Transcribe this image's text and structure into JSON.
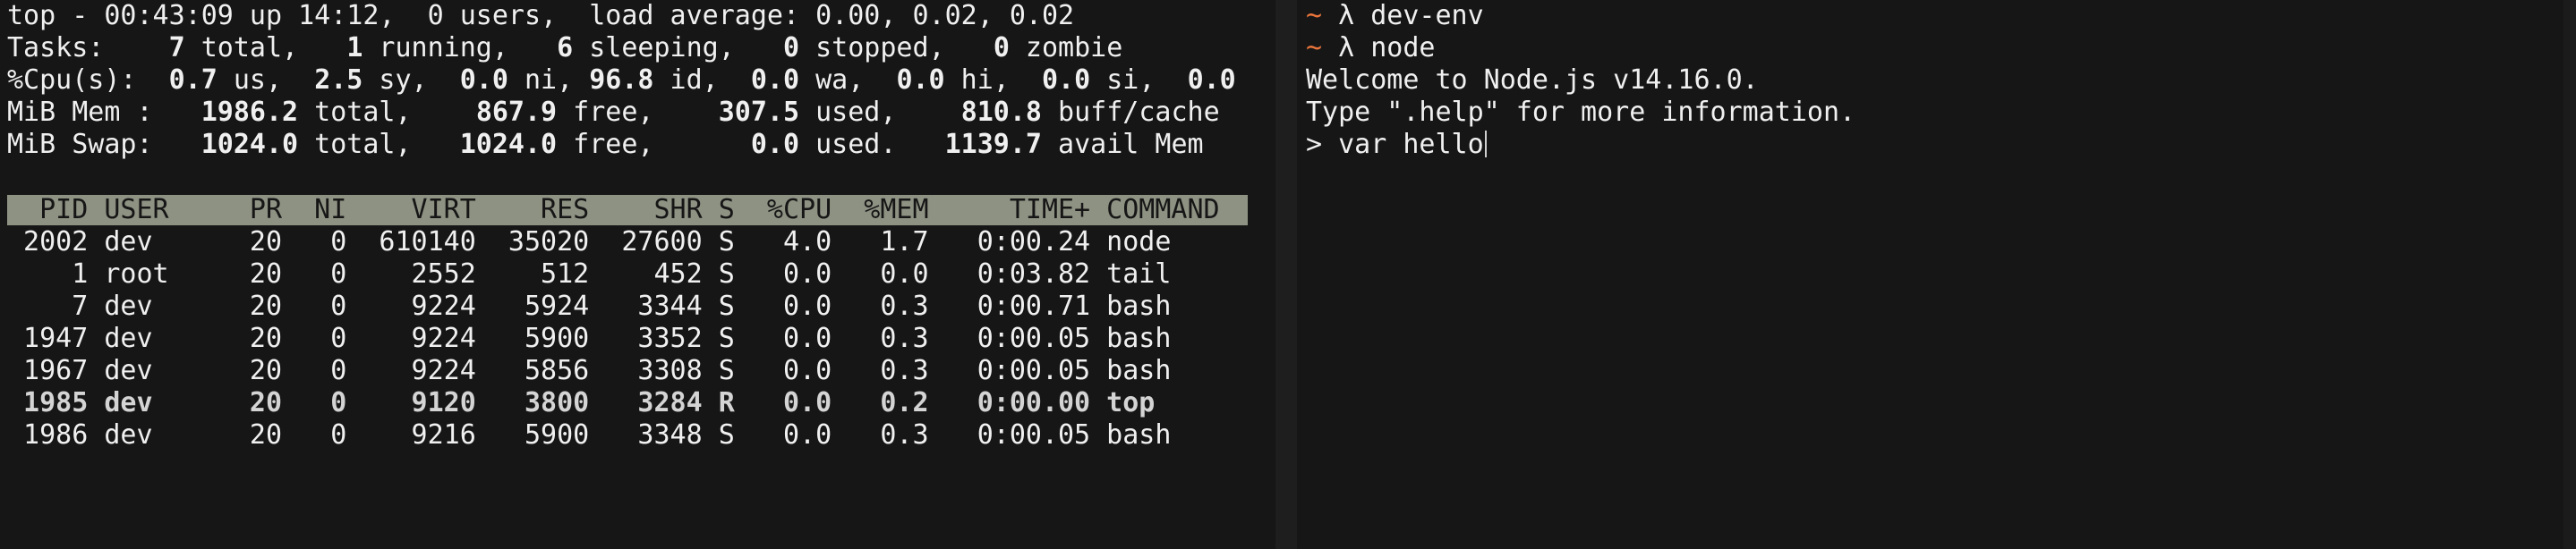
{
  "top_pane": {
    "summary": {
      "uptime_line": "top - 00:43:09 up 14:12,  0 users,  load average: 0.00, 0.02, 0.02",
      "tasks": {
        "label": "Tasks:",
        "total": "7",
        "running": "1",
        "sleeping": "6",
        "stopped": "0",
        "zombie": "0"
      },
      "cpu": {
        "label": "%Cpu(s):",
        "us": "0.7",
        "sy": "2.5",
        "ni": "0.0",
        "id": "96.8",
        "wa": "0.0",
        "hi": "0.0",
        "si": "0.0",
        "st": "0.0"
      },
      "mem": {
        "label": "MiB Mem :",
        "total": "1986.2",
        "free": "867.9",
        "used": "307.5",
        "buff_cache": "810.8"
      },
      "swap": {
        "label": "MiB Swap:",
        "total": "1024.0",
        "free": "1024.0",
        "used": "0.0",
        "avail_mem": "1139.7"
      }
    },
    "columns": [
      "PID",
      "USER",
      "PR",
      "NI",
      "VIRT",
      "RES",
      "SHR",
      "S",
      "%CPU",
      "%MEM",
      "TIME+",
      "COMMAND"
    ],
    "processes": [
      [
        "2002",
        "dev",
        "20",
        "0",
        "610140",
        "35020",
        "27600",
        "S",
        "4.0",
        "1.7",
        "0:00.24",
        "node"
      ],
      [
        "1",
        "root",
        "20",
        "0",
        "2552",
        "512",
        "452",
        "S",
        "0.0",
        "0.0",
        "0:03.82",
        "tail"
      ],
      [
        "7",
        "dev",
        "20",
        "0",
        "9224",
        "5924",
        "3344",
        "S",
        "0.0",
        "0.3",
        "0:00.71",
        "bash"
      ],
      [
        "1947",
        "dev",
        "20",
        "0",
        "9224",
        "5900",
        "3352",
        "S",
        "0.0",
        "0.3",
        "0:00.05",
        "bash"
      ],
      [
        "1967",
        "dev",
        "20",
        "0",
        "9224",
        "5856",
        "3308",
        "S",
        "0.0",
        "0.3",
        "0:00.05",
        "bash"
      ],
      [
        "1985",
        "dev",
        "20",
        "0",
        "9120",
        "3800",
        "3284",
        "R",
        "0.0",
        "0.2",
        "0:00.00",
        "top"
      ],
      [
        "1986",
        "dev",
        "20",
        "0",
        "9216",
        "5900",
        "3348",
        "S",
        "0.0",
        "0.3",
        "0:00.05",
        "bash"
      ]
    ]
  },
  "node_pane": {
    "prompt_tilde": "~",
    "prompt_symbol": "λ",
    "lines": [
      {
        "type": "prompt",
        "text": "dev-env"
      },
      {
        "type": "prompt",
        "text": "node"
      },
      {
        "type": "output",
        "text": "Welcome to Node.js v14.16.0."
      },
      {
        "type": "output",
        "text": "Type \".help\" for more information."
      },
      {
        "type": "repl",
        "text": "> var hello"
      }
    ]
  },
  "colors": {
    "background": "#161616",
    "header_bar": "#8e9283",
    "prompt_tilde": "#e8743b"
  }
}
